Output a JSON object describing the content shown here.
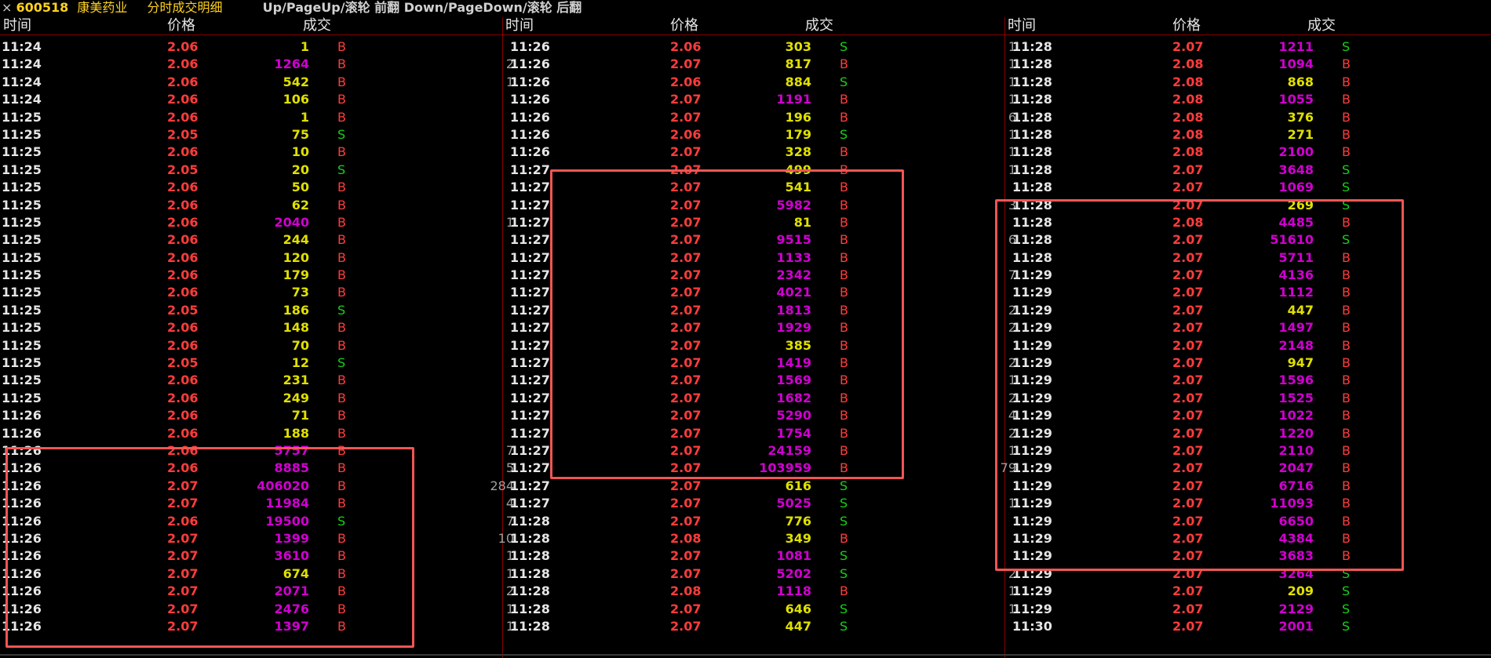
{
  "titlebar": {
    "close": "×",
    "code": "600518",
    "name": "康美药业",
    "mode": "分时成交明细",
    "hint": "Up/PageUp/滚轮 前翻 Down/PageDown/滚轮 后翻"
  },
  "headers": {
    "time": "时间",
    "price": "价格",
    "volume": "成交"
  },
  "colors": {
    "background": "#000000",
    "buy": "#ff3c3c",
    "sell": "#18d018",
    "large_volume": "#d000d0",
    "small_volume": "#e0e000",
    "highlight_box": "#f25555"
  },
  "columns": [
    {
      "rows": [
        {
          "time": "11:24",
          "price": "2.06",
          "vol": "1",
          "side": "B"
        },
        {
          "time": "11:24",
          "price": "2.06",
          "vol": "1264",
          "side": "B"
        },
        {
          "time": "11:24",
          "price": "2.06",
          "vol": "542",
          "side": "B"
        },
        {
          "time": "11:24",
          "price": "2.06",
          "vol": "106",
          "side": "B"
        },
        {
          "time": "11:25",
          "price": "2.06",
          "vol": "1",
          "side": "B"
        },
        {
          "time": "11:25",
          "price": "2.05",
          "vol": "75",
          "side": "S"
        },
        {
          "time": "11:25",
          "price": "2.06",
          "vol": "10",
          "side": "B"
        },
        {
          "time": "11:25",
          "price": "2.05",
          "vol": "20",
          "side": "S"
        },
        {
          "time": "11:25",
          "price": "2.06",
          "vol": "50",
          "side": "B"
        },
        {
          "time": "11:25",
          "price": "2.06",
          "vol": "62",
          "side": "B"
        },
        {
          "time": "11:25",
          "price": "2.06",
          "vol": "2040",
          "side": "B"
        },
        {
          "time": "11:25",
          "price": "2.06",
          "vol": "244",
          "side": "B"
        },
        {
          "time": "11:25",
          "price": "2.06",
          "vol": "120",
          "side": "B"
        },
        {
          "time": "11:25",
          "price": "2.06",
          "vol": "179",
          "side": "B"
        },
        {
          "time": "11:25",
          "price": "2.06",
          "vol": "73",
          "side": "B"
        },
        {
          "time": "11:25",
          "price": "2.05",
          "vol": "186",
          "side": "S"
        },
        {
          "time": "11:25",
          "price": "2.06",
          "vol": "148",
          "side": "B"
        },
        {
          "time": "11:25",
          "price": "2.06",
          "vol": "70",
          "side": "B"
        },
        {
          "time": "11:25",
          "price": "2.05",
          "vol": "12",
          "side": "S"
        },
        {
          "time": "11:25",
          "price": "2.06",
          "vol": "231",
          "side": "B"
        },
        {
          "time": "11:25",
          "price": "2.06",
          "vol": "249",
          "side": "B"
        },
        {
          "time": "11:26",
          "price": "2.06",
          "vol": "71",
          "side": "B"
        },
        {
          "time": "11:26",
          "price": "2.06",
          "vol": "188",
          "side": "B"
        },
        {
          "time": "11:26",
          "price": "2.06",
          "vol": "5757",
          "side": "B"
        },
        {
          "time": "11:26",
          "price": "2.06",
          "vol": "8885",
          "side": "B"
        },
        {
          "time": "11:26",
          "price": "2.07",
          "vol": "406020",
          "side": "B"
        },
        {
          "time": "11:26",
          "price": "2.07",
          "vol": "11984",
          "side": "B"
        },
        {
          "time": "11:26",
          "price": "2.06",
          "vol": "19500",
          "side": "S"
        },
        {
          "time": "11:26",
          "price": "2.07",
          "vol": "1399",
          "side": "B"
        },
        {
          "time": "11:26",
          "price": "2.07",
          "vol": "3610",
          "side": "B"
        },
        {
          "time": "11:26",
          "price": "2.07",
          "vol": "674",
          "side": "B"
        },
        {
          "time": "11:26",
          "price": "2.07",
          "vol": "2071",
          "side": "B"
        },
        {
          "time": "11:26",
          "price": "2.07",
          "vol": "2476",
          "side": "B"
        },
        {
          "time": "11:26",
          "price": "2.07",
          "vol": "1397",
          "side": "B"
        }
      ]
    },
    {
      "rows": [
        {
          "pre": "",
          "time": "11:26",
          "price": "2.06",
          "vol": "303",
          "side": "S"
        },
        {
          "pre": "2",
          "time": "11:26",
          "price": "2.07",
          "vol": "817",
          "side": "B"
        },
        {
          "pre": "1",
          "time": "11:26",
          "price": "2.06",
          "vol": "884",
          "side": "S"
        },
        {
          "pre": "",
          "time": "11:26",
          "price": "2.07",
          "vol": "1191",
          "side": "B"
        },
        {
          "pre": "",
          "time": "11:26",
          "price": "2.07",
          "vol": "196",
          "side": "B"
        },
        {
          "pre": "",
          "time": "11:26",
          "price": "2.06",
          "vol": "179",
          "side": "S"
        },
        {
          "pre": "",
          "time": "11:26",
          "price": "2.07",
          "vol": "328",
          "side": "B"
        },
        {
          "pre": "",
          "time": "11:27",
          "price": "2.07",
          "vol": "499",
          "side": "B"
        },
        {
          "pre": "",
          "time": "11:27",
          "price": "2.07",
          "vol": "541",
          "side": "B"
        },
        {
          "pre": "",
          "time": "11:27",
          "price": "2.07",
          "vol": "5982",
          "side": "B"
        },
        {
          "pre": "1",
          "time": "11:27",
          "price": "2.07",
          "vol": "81",
          "side": "B"
        },
        {
          "pre": "",
          "time": "11:27",
          "price": "2.07",
          "vol": "9515",
          "side": "B"
        },
        {
          "pre": "",
          "time": "11:27",
          "price": "2.07",
          "vol": "1133",
          "side": "B"
        },
        {
          "pre": "",
          "time": "11:27",
          "price": "2.07",
          "vol": "2342",
          "side": "B"
        },
        {
          "pre": "",
          "time": "11:27",
          "price": "2.07",
          "vol": "4021",
          "side": "B"
        },
        {
          "pre": "",
          "time": "11:27",
          "price": "2.07",
          "vol": "1813",
          "side": "B"
        },
        {
          "pre": "",
          "time": "11:27",
          "price": "2.07",
          "vol": "1929",
          "side": "B"
        },
        {
          "pre": "",
          "time": "11:27",
          "price": "2.07",
          "vol": "385",
          "side": "B"
        },
        {
          "pre": "",
          "time": "11:27",
          "price": "2.07",
          "vol": "1419",
          "side": "B"
        },
        {
          "pre": "",
          "time": "11:27",
          "price": "2.07",
          "vol": "1569",
          "side": "B"
        },
        {
          "pre": "",
          "time": "11:27",
          "price": "2.07",
          "vol": "1682",
          "side": "B"
        },
        {
          "pre": "",
          "time": "11:27",
          "price": "2.07",
          "vol": "5290",
          "side": "B"
        },
        {
          "pre": "",
          "time": "11:27",
          "price": "2.07",
          "vol": "1754",
          "side": "B"
        },
        {
          "pre": "7",
          "time": "11:27",
          "price": "2.07",
          "vol": "24159",
          "side": "B"
        },
        {
          "pre": "5",
          "time": "11:27",
          "price": "2.07",
          "vol": "103959",
          "side": "B"
        },
        {
          "pre": "284",
          "time": "11:27",
          "price": "2.07",
          "vol": "616",
          "side": "S"
        },
        {
          "pre": "4",
          "time": "11:27",
          "price": "2.07",
          "vol": "5025",
          "side": "S"
        },
        {
          "pre": "7",
          "time": "11:28",
          "price": "2.07",
          "vol": "776",
          "side": "S"
        },
        {
          "pre": "10",
          "time": "11:28",
          "price": "2.08",
          "vol": "349",
          "side": "B"
        },
        {
          "pre": "1",
          "time": "11:28",
          "price": "2.07",
          "vol": "1081",
          "side": "S"
        },
        {
          "pre": "1",
          "time": "11:28",
          "price": "2.07",
          "vol": "5202",
          "side": "S"
        },
        {
          "pre": "2",
          "time": "11:28",
          "price": "2.08",
          "vol": "1118",
          "side": "B"
        },
        {
          "pre": "1",
          "time": "11:28",
          "price": "2.07",
          "vol": "646",
          "side": "S"
        },
        {
          "pre": "1",
          "time": "11:28",
          "price": "2.07",
          "vol": "447",
          "side": "S"
        }
      ]
    },
    {
      "rows": [
        {
          "pre": "1",
          "time": "11:28",
          "price": "2.07",
          "vol": "1211",
          "side": "S"
        },
        {
          "pre": "1",
          "time": "11:28",
          "price": "2.08",
          "vol": "1094",
          "side": "B"
        },
        {
          "pre": "1",
          "time": "11:28",
          "price": "2.08",
          "vol": "868",
          "side": "B"
        },
        {
          "pre": "1",
          "time": "11:28",
          "price": "2.08",
          "vol": "1055",
          "side": "B"
        },
        {
          "pre": "6",
          "time": "11:28",
          "price": "2.08",
          "vol": "376",
          "side": "B"
        },
        {
          "pre": "1",
          "time": "11:28",
          "price": "2.08",
          "vol": "271",
          "side": "B"
        },
        {
          "pre": "1",
          "time": "11:28",
          "price": "2.08",
          "vol": "2100",
          "side": "B"
        },
        {
          "pre": "1",
          "time": "11:28",
          "price": "2.07",
          "vol": "3648",
          "side": "S"
        },
        {
          "pre": "",
          "time": "11:28",
          "price": "2.07",
          "vol": "1069",
          "side": "S"
        },
        {
          "pre": "3",
          "time": "11:28",
          "price": "2.07",
          "vol": "269",
          "side": "S"
        },
        {
          "pre": "",
          "time": "11:28",
          "price": "2.08",
          "vol": "4485",
          "side": "B"
        },
        {
          "pre": "6",
          "time": "11:28",
          "price": "2.07",
          "vol": "51610",
          "side": "S"
        },
        {
          "pre": "",
          "time": "11:28",
          "price": "2.07",
          "vol": "5711",
          "side": "B"
        },
        {
          "pre": "7",
          "time": "11:29",
          "price": "2.07",
          "vol": "4136",
          "side": "B"
        },
        {
          "pre": "",
          "time": "11:29",
          "price": "2.07",
          "vol": "1112",
          "side": "B"
        },
        {
          "pre": "2",
          "time": "11:29",
          "price": "2.07",
          "vol": "447",
          "side": "B"
        },
        {
          "pre": "2",
          "time": "11:29",
          "price": "2.07",
          "vol": "1497",
          "side": "B"
        },
        {
          "pre": "",
          "time": "11:29",
          "price": "2.07",
          "vol": "2148",
          "side": "B"
        },
        {
          "pre": "2",
          "time": "11:29",
          "price": "2.07",
          "vol": "947",
          "side": "B"
        },
        {
          "pre": "1",
          "time": "11:29",
          "price": "2.07",
          "vol": "1596",
          "side": "B"
        },
        {
          "pre": "2",
          "time": "11:29",
          "price": "2.07",
          "vol": "1525",
          "side": "B"
        },
        {
          "pre": "4",
          "time": "11:29",
          "price": "2.07",
          "vol": "1022",
          "side": "B"
        },
        {
          "pre": "2",
          "time": "11:29",
          "price": "2.07",
          "vol": "1220",
          "side": "B"
        },
        {
          "pre": "1",
          "time": "11:29",
          "price": "2.07",
          "vol": "2110",
          "side": "B"
        },
        {
          "pre": "79",
          "time": "11:29",
          "price": "2.07",
          "vol": "2047",
          "side": "B"
        },
        {
          "pre": "",
          "time": "11:29",
          "price": "2.07",
          "vol": "6716",
          "side": "B"
        },
        {
          "pre": "1",
          "time": "11:29",
          "price": "2.07",
          "vol": "11093",
          "side": "B"
        },
        {
          "pre": "",
          "time": "11:29",
          "price": "2.07",
          "vol": "6650",
          "side": "B"
        },
        {
          "pre": "",
          "time": "11:29",
          "price": "2.07",
          "vol": "4384",
          "side": "B"
        },
        {
          "pre": "",
          "time": "11:29",
          "price": "2.07",
          "vol": "3683",
          "side": "B"
        },
        {
          "pre": "2",
          "time": "11:29",
          "price": "2.07",
          "vol": "3264",
          "side": "S"
        },
        {
          "pre": "1",
          "time": "11:29",
          "price": "2.07",
          "vol": "209",
          "side": "S"
        },
        {
          "pre": "1",
          "time": "11:29",
          "price": "2.07",
          "vol": "2129",
          "side": "S"
        },
        {
          "pre": "",
          "time": "11:30",
          "price": "2.07",
          "vol": "2001",
          "side": "S"
        }
      ]
    }
  ]
}
